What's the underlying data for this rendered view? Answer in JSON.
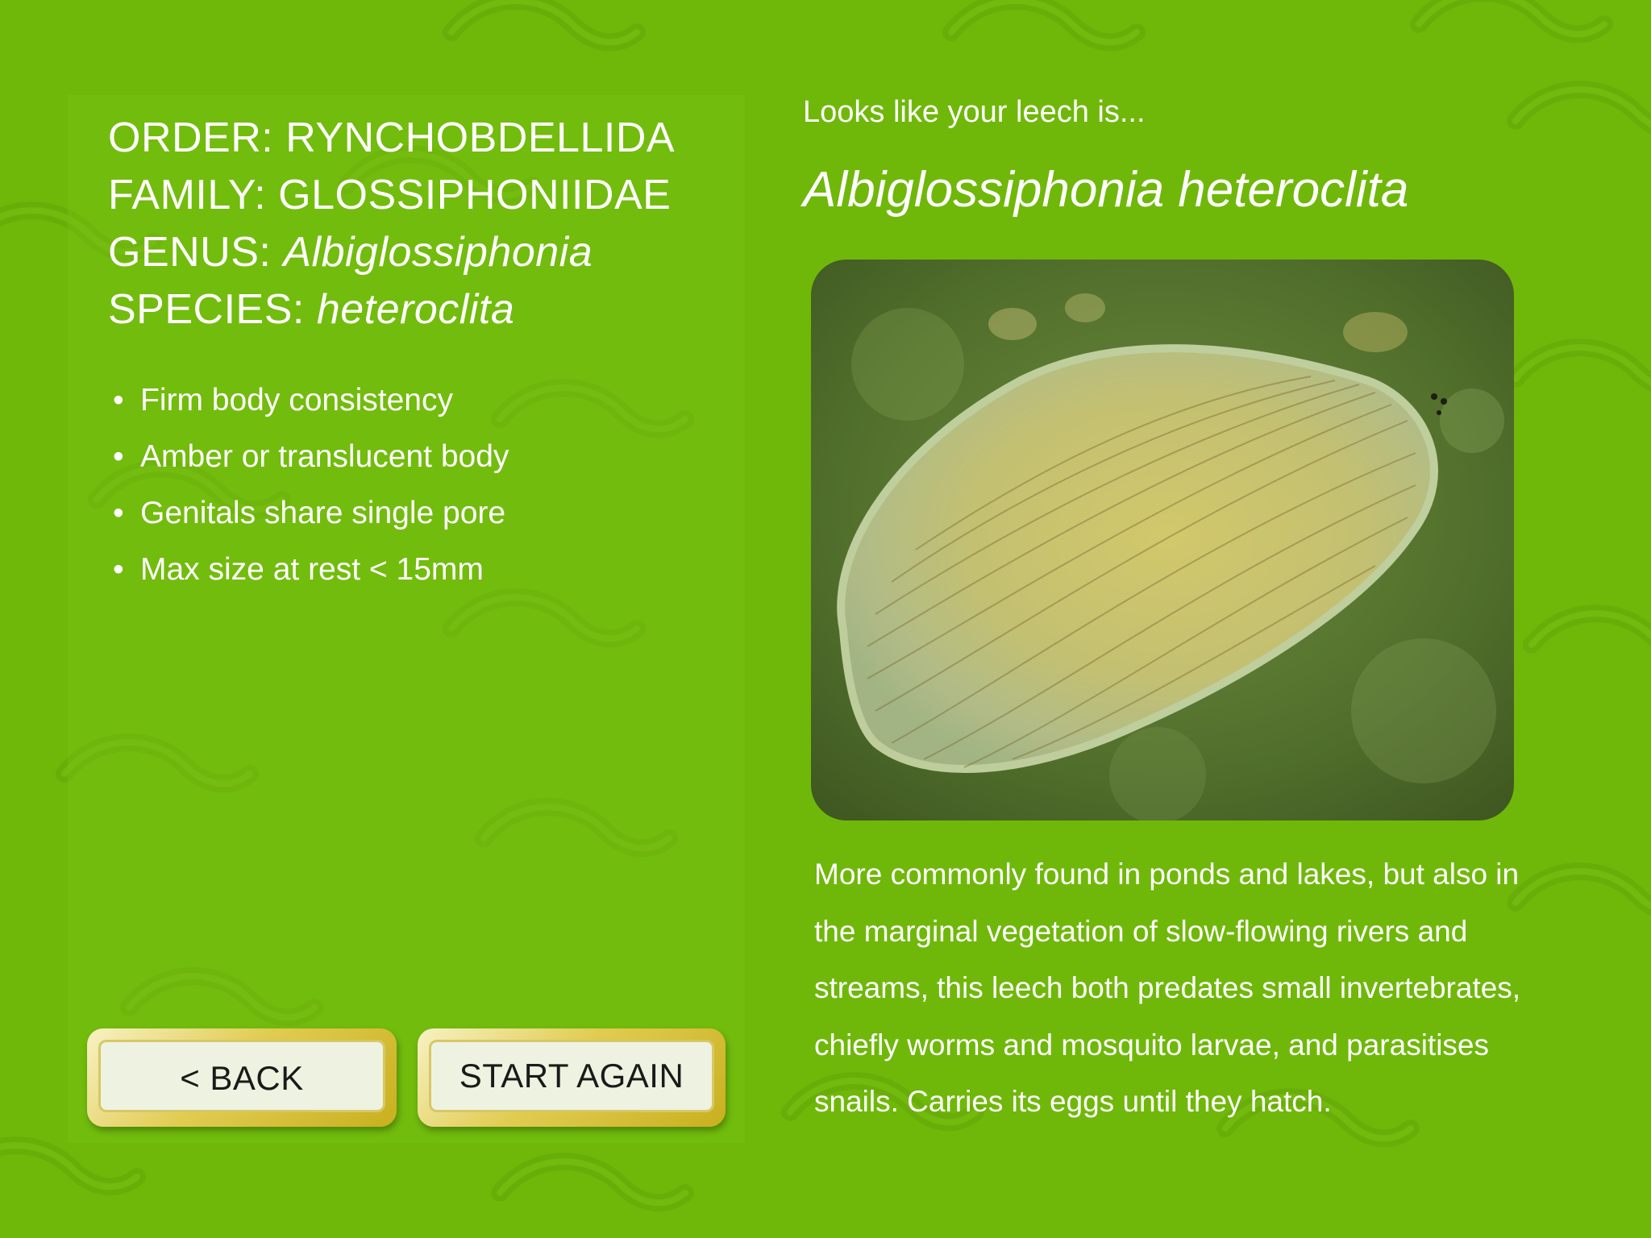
{
  "taxonomy": {
    "order_label": "ORDER:",
    "order_value": "RYNCHOBDELLIDA",
    "family_label": "FAMILY:",
    "family_value": "GLOSSIPHONIIDAE",
    "genus_label": "GENUS:",
    "genus_value": "Albiglossiphonia",
    "species_label": "SPECIES:",
    "species_value": "heteroclita"
  },
  "traits": {
    "bullet": "•",
    "items": [
      "Firm body consistency",
      "Amber or translucent body",
      "Genitals share single pore",
      "Max size at rest < 15mm"
    ]
  },
  "buttons": {
    "back_label": "< BACK",
    "start_again_label": "START AGAIN"
  },
  "result": {
    "lead": "Looks like your leech is...",
    "species_name": "Albiglossiphonia heteroclita",
    "description": "More commonly found in ponds and lakes, but also in the marginal vegetation of slow-flowing rivers and streams, this leech both predates small invertebrates, chiefly worms and mosquito larvae, and parasitises snails. Carries its eggs until they hatch."
  },
  "colors": {
    "background": "#6fb80a",
    "text": "#ffffff",
    "button_face": "#eef3e1",
    "button_frame": "#d4bc2e"
  },
  "icons": {
    "background_pattern": "leech-silhouette-pattern",
    "photo": "leech-specimen-photo"
  }
}
